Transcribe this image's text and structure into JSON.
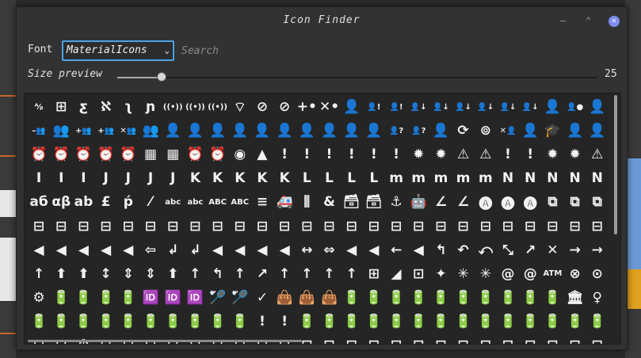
{
  "window": {
    "title": "Icon Finder",
    "minimize_glyph": "–",
    "maximize_glyph": "⌃",
    "close_glyph": "✕"
  },
  "font": {
    "label": "Font",
    "selected": "MaterialIcons",
    "chevron": "⌄"
  },
  "search": {
    "placeholder": "Search"
  },
  "size": {
    "label": "Size preview",
    "value": "25",
    "fraction": 0.09
  },
  "icons": [
    "ᴬ⁄ᵦ",
    "⊞",
    "ƹ",
    "ℵ",
    "ʅ",
    "ɲ",
    "((•))",
    "((•))",
    "((•))",
    "⌔",
    "⊘",
    "⊘",
    "+•",
    "✕•",
    "👤",
    "👤!",
    "👤!",
    "👤↓",
    "👤↓",
    "👤↓",
    "👤↓",
    "👤↓",
    "👤↓",
    "👤",
    "👤●",
    "👤",
    "–👥",
    "👥",
    "+👥",
    "+👥",
    "✕👥",
    "👥",
    "👤",
    "👤",
    "👤",
    "👤",
    "👤",
    "👤",
    "👤",
    "👤",
    "👤",
    "👤",
    "👤?",
    "👤?",
    "👤",
    "⟳",
    "⊚",
    "✕👤",
    "👤",
    "🎓",
    "👤",
    "👤",
    "⏰",
    "⏰",
    "⏰",
    "⏰",
    "⏰",
    "▦",
    "▦",
    "⏰",
    "⏰",
    "◉",
    "▲",
    "!",
    "!",
    "!",
    "!",
    "!",
    "!",
    "✹",
    "✹",
    "⚠",
    "⚠",
    "!",
    "!",
    "✹",
    "✹",
    "⚠",
    "I",
    "I",
    "I",
    "J",
    "J",
    "J",
    "J",
    "K",
    "K",
    "K",
    "K",
    "K",
    "L",
    "L",
    "L",
    "L",
    "m",
    "m",
    "m",
    "m",
    "m",
    "N",
    "N",
    "N",
    "N",
    "N",
    "aб",
    "αβ",
    "ab",
    "£",
    "ṕ",
    "⁄",
    "abc",
    "abc",
    "ABC",
    "ABC",
    "≡",
    "🚑",
    "⫼",
    "&",
    "🗃",
    "🗃",
    "⚓",
    "🤖",
    "∠",
    "∠",
    "🅐",
    "🅐",
    "🅐",
    "⧉",
    "⧉",
    "⧉",
    "⊟",
    "⊟",
    "⊟",
    "⊟",
    "⊟",
    "⊟",
    "⊟",
    "⊟",
    "⊟",
    "⊟",
    "⊟",
    "⊟",
    "⊟",
    "⊟",
    "⊟",
    "⊟",
    "⊟",
    "⊟",
    "⊟",
    "⊟",
    "⊟",
    "⊟",
    "⊟",
    "⊟",
    "⊟",
    "⊟",
    "◀",
    "◀",
    "◀",
    "◀",
    "◀",
    "⇦",
    "↲",
    "↲",
    "◀",
    "◀",
    "◀",
    "◀",
    "↔",
    "⇔",
    "◀",
    "◀",
    "←",
    "◀",
    "↰",
    "↶",
    "⤺",
    "⤡",
    "↗",
    "✕",
    "→",
    "→",
    "↑",
    "⬆",
    "⬆",
    "↕",
    "⇕",
    "⇕",
    "⬆",
    "↑",
    "↰",
    "↑",
    "↗",
    "↑",
    "↑",
    "↑",
    "↑",
    "⊞",
    "◢",
    "⊡",
    "✦",
    "✳",
    "✳",
    "@",
    "@",
    "ATM",
    "⊗",
    "⊙",
    "⚙",
    "🔋",
    "🔋",
    "🔋",
    "🔋",
    "🆔",
    "🆔",
    "🆔",
    "🏸",
    "🏸",
    "✓",
    "👜",
    "👜",
    "👜",
    "🔋",
    "🔋",
    "🔋",
    "🔋",
    "🔋",
    "🔋",
    "🔋",
    "🔋",
    "🔋",
    "🔋",
    "🏛",
    "♀",
    "🔋",
    "🔋",
    "🔋",
    "🔋",
    "🔋",
    "🔋",
    "🔋",
    "🔋",
    "🔋",
    "🔋",
    "!",
    "!",
    "🔋",
    "🔋",
    "🔋",
    "🔋",
    "🔋",
    "🔋",
    "🔋",
    "🔋",
    "🔋",
    "🔋",
    "🔋",
    "🔋",
    "🔋",
    "🔋",
    "⊟",
    "⊟",
    "⏱",
    "⊟",
    "⊟",
    "⊟",
    "⊟",
    "⊟",
    "⊟",
    "⊟",
    "⊟",
    "⊟",
    "⊟",
    "⊟",
    "⊟",
    "⊟",
    "⊟",
    "⊟",
    "⊟",
    "⊟",
    "⊟",
    "⊟",
    "⊟",
    "⊟",
    "⊟",
    "⊟"
  ],
  "colors": {
    "accent": "#4da3e4",
    "close_button": "#7f8cf0",
    "background": "#323232"
  }
}
